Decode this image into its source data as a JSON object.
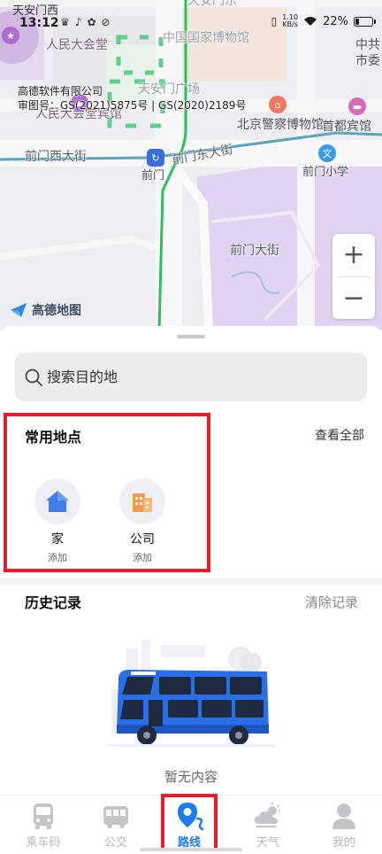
{
  "status_bar": {
    "street": "天安门西",
    "time": "13:12",
    "net_speed_value": "1.10",
    "net_speed_unit": "KB/s",
    "battery_text": "22%",
    "battery_level": 0.22
  },
  "map": {
    "labels": {
      "top_center": "天安门东",
      "great_hall": "人民大会堂",
      "national_museum": "中国国家博物馆",
      "tiananmen_square": "天安门广场",
      "great_hall_hotel": "人民大会堂宾馆",
      "police_museum": "北京警察博物馆",
      "capital_hotel": "首都宾馆",
      "right_top_1": "中共",
      "right_top_2": "市委",
      "qianmen_west": "前门西大街",
      "qianmen_east": "前门东大街",
      "qianmen_station": "前门",
      "qianmen_school": "前门小学",
      "qianmen_street": "前门大街"
    },
    "copyright_line1": "高德软件有限公司",
    "copyright_line2": "审图号：GS(2021)5875号 | GS(2020)2189号",
    "logo_text": "高德地图",
    "zoom_in": "+",
    "zoom_out": "−"
  },
  "search": {
    "placeholder": "搜索目的地"
  },
  "frequent_places": {
    "title": "常用地点",
    "view_all": "查看全部",
    "items": [
      {
        "name": "家",
        "action": "添加",
        "icon": "house-icon"
      },
      {
        "name": "公司",
        "action": "添加",
        "icon": "building-icon"
      }
    ]
  },
  "history": {
    "title": "历史记录",
    "clear": "清除记录",
    "empty_text": "暂无内容"
  },
  "tabs": [
    {
      "label": "乘车码",
      "icon": "bus-code-icon",
      "active": false
    },
    {
      "label": "公交",
      "icon": "bus-icon",
      "active": false
    },
    {
      "label": "路线",
      "icon": "route-pin-icon",
      "active": true
    },
    {
      "label": "天气",
      "icon": "weather-icon",
      "active": false
    },
    {
      "label": "我的",
      "icon": "profile-icon",
      "active": false
    }
  ],
  "colors": {
    "accent": "#1f7bf2",
    "highlight_box": "#e0202a",
    "inactive_tab": "#b8b8bc"
  }
}
